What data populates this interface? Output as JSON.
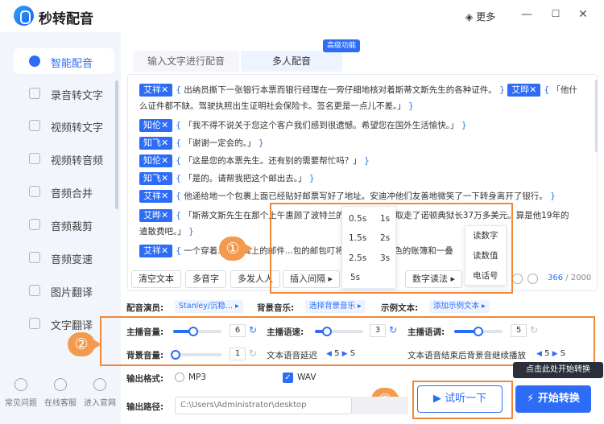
{
  "app": {
    "title": "秒转配音",
    "more": "更多",
    "min": "—",
    "max": "☐",
    "close": "✕"
  },
  "sidebar": {
    "items": [
      {
        "label": "智能配音",
        "icon": "mic-icon"
      },
      {
        "label": "录音转文字",
        "icon": "text-icon"
      },
      {
        "label": "视频转文字",
        "icon": "video-text-icon"
      },
      {
        "label": "视频转音频",
        "icon": "video-audio-icon"
      },
      {
        "label": "音频合并",
        "icon": "merge-icon"
      },
      {
        "label": "音频裁剪",
        "icon": "cut-icon"
      },
      {
        "label": "音频变速",
        "icon": "speed-icon"
      },
      {
        "label": "图片翻译",
        "icon": "image-translate-icon"
      },
      {
        "label": "文字翻译",
        "icon": "translate-icon"
      }
    ],
    "bottom": [
      {
        "label": "常见问题",
        "icon": "help-icon"
      },
      {
        "label": "在线客服",
        "icon": "support-icon"
      },
      {
        "label": "进入官网",
        "icon": "home-icon"
      }
    ]
  },
  "tabs": {
    "text": "输入文字进行配音",
    "multi": "多人配音",
    "badge": "高级功能"
  },
  "lines": [
    {
      "speaker": "艾祥✕",
      "open": "{",
      "text": "出纳员撕下一张银行本票而银行经理在一旁仔细地核对着斯蒂文斯先生的各种证件。",
      "close": "}",
      "speaker2": "艾晔✕",
      "open2": "{",
      "text2": "「他什"
    },
    {
      "text": "么证件都不缺。驾驶执照出生证明社会保险卡。签名更是一点儿不差。」",
      "close": "}"
    },
    {
      "speaker": "知伦✕",
      "open": "{",
      "text": "「我不得不说关于您这个客户我们感到很遗憾。希望您在国外生活愉快。」",
      "close": "}"
    },
    {
      "speaker": "知飞✕",
      "open": "{",
      "text": "「谢谢一定会的。」",
      "close": "}"
    },
    {
      "speaker": "知伦✕",
      "open": "{",
      "text": "「这是您的本票先生。还有别的需要帮忙吗？」",
      "close": "}"
    },
    {
      "speaker": "知飞✕",
      "open": "{",
      "text": "「是的。请帮我把这个邮出去。」",
      "close": "}"
    },
    {
      "speaker": "艾祥✕",
      "open": "{",
      "text": "他递给地一个包裹上面已经贴好邮票写好了地址。安迪冲他们友善地微笑了一下转身离开了银行。",
      "close": "}"
    },
    {
      "speaker": "艾晔✕",
      "open": "{",
      "text": "「斯蒂文斯先生在那个上午惠顾了波特兰的几家银行总共取走了诺顿典狱长37万多美元。算是他19年的"
    },
    {
      "text": "遣散费吧。」",
      "close": "}"
    },
    {
      "speaker": "艾祥✕",
      "open": "{",
      "text": "一个穿着...在公寓上的邮件...包的邮包叮将其撕开...面黑色的账簿和一叠"
    }
  ],
  "popup": {
    "values": [
      "0.5s",
      "1s",
      "1.5s",
      "2s",
      "2.5s",
      "3s",
      "5s"
    ]
  },
  "popup2": {
    "items": [
      "读数字",
      "读数值",
      "电话号"
    ]
  },
  "toolbar": {
    "clear": "清空文本",
    "multi": "多音字",
    "multi_person": "多发人人",
    "pause": "插入间隔 ▸",
    "digit": "数字读法 ▸",
    "count": "366",
    "total": "/ 2000"
  },
  "callouts": [
    "①",
    "②",
    "③"
  ],
  "settings": {
    "voice_label": "配音演员:",
    "voice_val": "Stanley/沉稳... ▸",
    "bgm_label": "背景音乐:",
    "bgm_val": "选择背景音乐 ▸",
    "sample_label": "示例文本:",
    "sample_val": "添加示例文本 ▸",
    "host_vol": "主播音量:",
    "host_vol_val": "6",
    "host_speed": "主播语速:",
    "host_speed_val": "3",
    "host_pitch": "主播语调:",
    "host_pitch_val": "5",
    "bg_vol": "背景音量:",
    "bg_vol_val": "1",
    "delay_label": "文本语音延迟",
    "delay_val": "5",
    "delay_unit": "S",
    "end_label": "文本语音结束后背景音继续播放",
    "end_val": "5",
    "end_unit": "S"
  },
  "levels": {
    "host_vol": 0.42,
    "host_speed": 0.25,
    "host_pitch": 0.5,
    "bg_vol": 0.05
  },
  "output": {
    "format_label": "输出格式:",
    "mp3": "MP3",
    "wav": "WAV",
    "path_label": "输出路径:",
    "path": "C:\\Users\\Administrator\\desktop"
  },
  "actions": {
    "try": "试听一下",
    "start": "开始转换",
    "tip": "点击此处开始转换"
  }
}
